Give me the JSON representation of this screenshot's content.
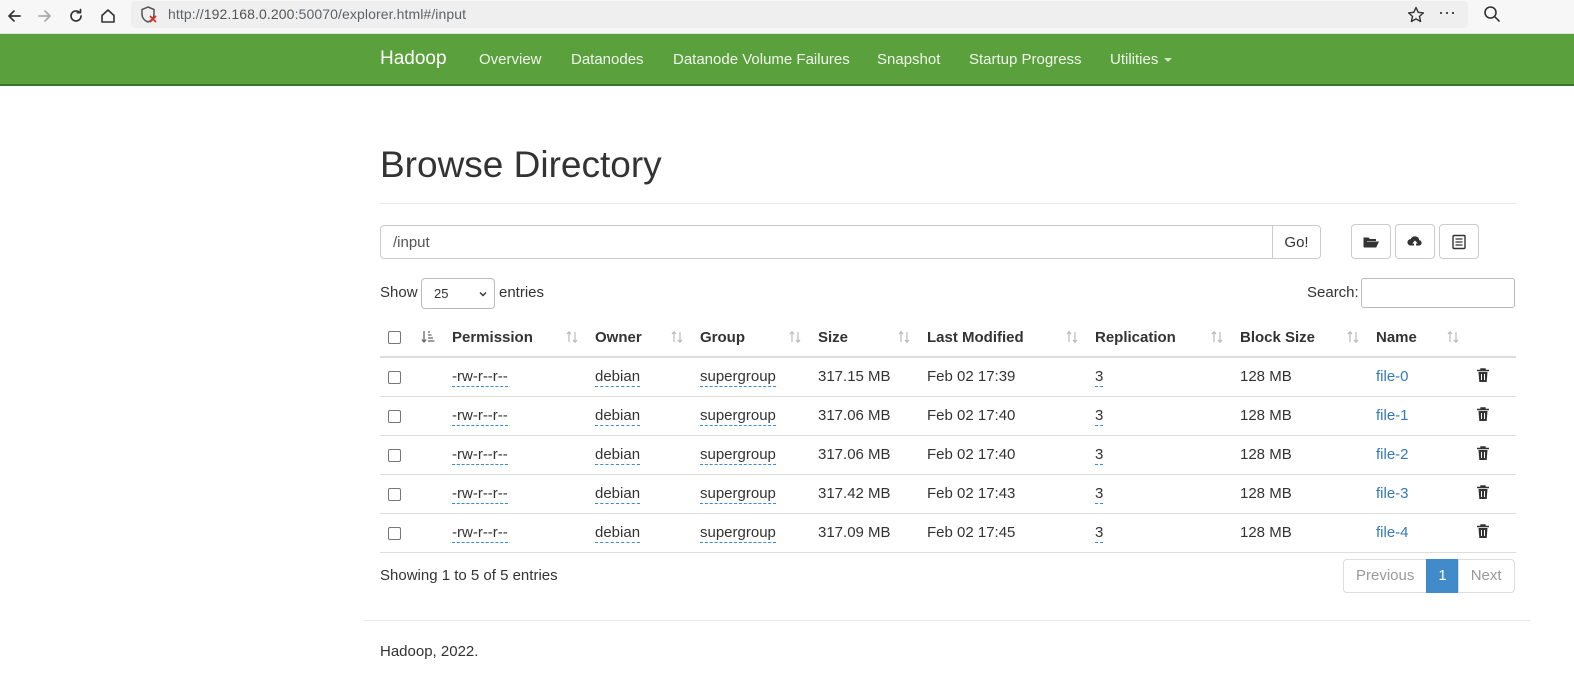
{
  "browser": {
    "url_prefix": "http://",
    "url_host": "192.168.0.200",
    "url_rest": ":50070/explorer.html#/input"
  },
  "navbar": {
    "brand": "Hadoop",
    "items": [
      {
        "label": "Overview"
      },
      {
        "label": "Datanodes"
      },
      {
        "label": "Datanode Volume Failures"
      },
      {
        "label": "Snapshot"
      },
      {
        "label": "Startup Progress"
      },
      {
        "label": "Utilities"
      }
    ]
  },
  "main": {
    "title": "Browse Directory",
    "path_value": "/input",
    "go_label": "Go!",
    "tools": [
      {
        "icon": "folder-open-icon"
      },
      {
        "icon": "cloud-upload-icon"
      },
      {
        "icon": "list-icon"
      }
    ],
    "show_label": "Show",
    "page_size": "25",
    "entries_label": "entries",
    "search_label": "Search:",
    "search_value": ""
  },
  "table": {
    "headers": {
      "permission": "Permission",
      "owner": "Owner",
      "group": "Group",
      "size": "Size",
      "last_modified": "Last Modified",
      "replication": "Replication",
      "block_size": "Block Size",
      "name": "Name"
    },
    "rows": [
      {
        "permission": "-rw-r--r--",
        "owner": "debian",
        "group": "supergroup",
        "size": "317.15 MB",
        "last_modified": "Feb 02 17:39",
        "replication": "3",
        "block_size": "128 MB",
        "name": "file-0"
      },
      {
        "permission": "-rw-r--r--",
        "owner": "debian",
        "group": "supergroup",
        "size": "317.06 MB",
        "last_modified": "Feb 02 17:40",
        "replication": "3",
        "block_size": "128 MB",
        "name": "file-1"
      },
      {
        "permission": "-rw-r--r--",
        "owner": "debian",
        "group": "supergroup",
        "size": "317.06 MB",
        "last_modified": "Feb 02 17:40",
        "replication": "3",
        "block_size": "128 MB",
        "name": "file-2"
      },
      {
        "permission": "-rw-r--r--",
        "owner": "debian",
        "group": "supergroup",
        "size": "317.42 MB",
        "last_modified": "Feb 02 17:43",
        "replication": "3",
        "block_size": "128 MB",
        "name": "file-3"
      },
      {
        "permission": "-rw-r--r--",
        "owner": "debian",
        "group": "supergroup",
        "size": "317.09 MB",
        "last_modified": "Feb 02 17:45",
        "replication": "3",
        "block_size": "128 MB",
        "name": "file-4"
      }
    ]
  },
  "pagination": {
    "info": "Showing 1 to 5 of 5 entries",
    "previous": "Previous",
    "current": "1",
    "next": "Next"
  },
  "footer": {
    "text": "Hadoop, 2022."
  },
  "colors": {
    "navbar": "#5aa03c",
    "link": "#337ab7",
    "active_page": "#428bca"
  }
}
